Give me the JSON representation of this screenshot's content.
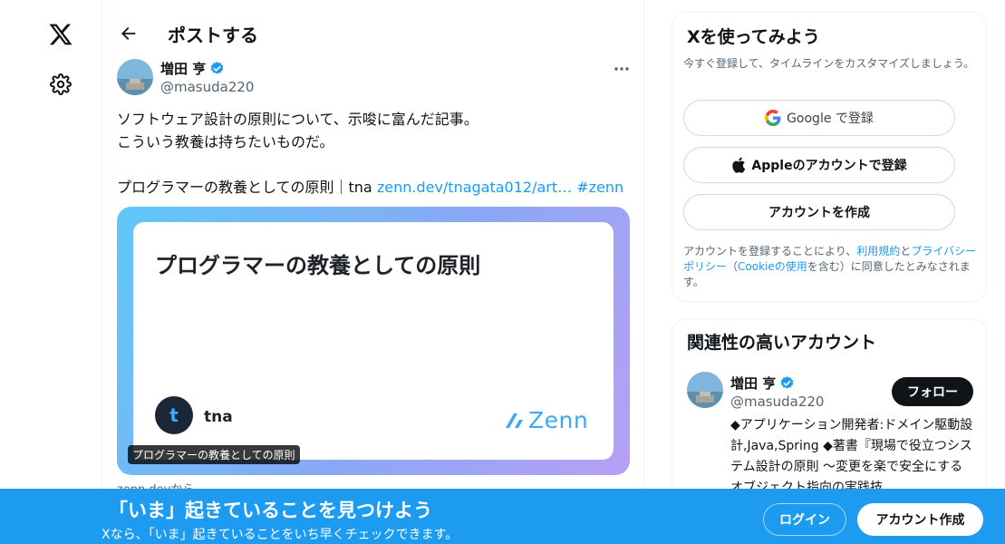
{
  "nav": {
    "logo": "x-logo-icon",
    "settings": "gear-icon"
  },
  "header": {
    "title": "ポストする"
  },
  "post": {
    "author_name": "増田 亨",
    "author_handle": "@masuda220",
    "lines": [
      "ソフトウェア設計の原則について、示唆に富んだ記事。",
      "こういう教養は持ちたいものだ。"
    ],
    "link_line_prefix": "プログラマーの教養としての原則｜tna ",
    "link_url": "zenn.dev/tnagata012/art…",
    "link_hashtag": " #zenn"
  },
  "card": {
    "title": "プログラマーの教養としての原則",
    "author_initial": "t",
    "author_name": "tna",
    "brand": "Zenn",
    "caption": "プログラマーの教養としての原則",
    "source": "zenn.devから"
  },
  "signup": {
    "title": "Xを使ってみよう",
    "subtitle": "今すぐ登録して、タイムラインをカスタマイズしましょう。",
    "google_label": "Google で登録",
    "apple_label": "Appleのアカウントで登録",
    "create_label": "アカウントを作成",
    "legal_prefix": "アカウントを登録することにより、",
    "terms": "利用規約",
    "and": "と",
    "privacy": "プライバシーポリシー",
    "paren_open": "（",
    "cookie": "Cookieの使用",
    "legal_suffix": "を含む）に同意したとみなされます。"
  },
  "related": {
    "title": "関連性の高いアカウント",
    "name": "増田 亨",
    "handle": "@masuda220",
    "follow_label": "フォロー",
    "bio": "◆アプリケーション開発者:ドメイン駆動設計,Java,Spring ◆著書『現場で役立つシステム設計の原則 〜変更を楽で安全にするオブジェクト指向の実践技"
  },
  "banner": {
    "title": "「いま」起きていることを見つけよう",
    "subtitle": "Xなら、「いま」起きていることをいち早くチェックできます。",
    "login_label": "ログイン",
    "signup_label": "アカウント作成"
  },
  "colors": {
    "accent": "#1d9bf0",
    "text": "#0f1419",
    "muted": "#536471",
    "verified": "#1d9bf0"
  }
}
